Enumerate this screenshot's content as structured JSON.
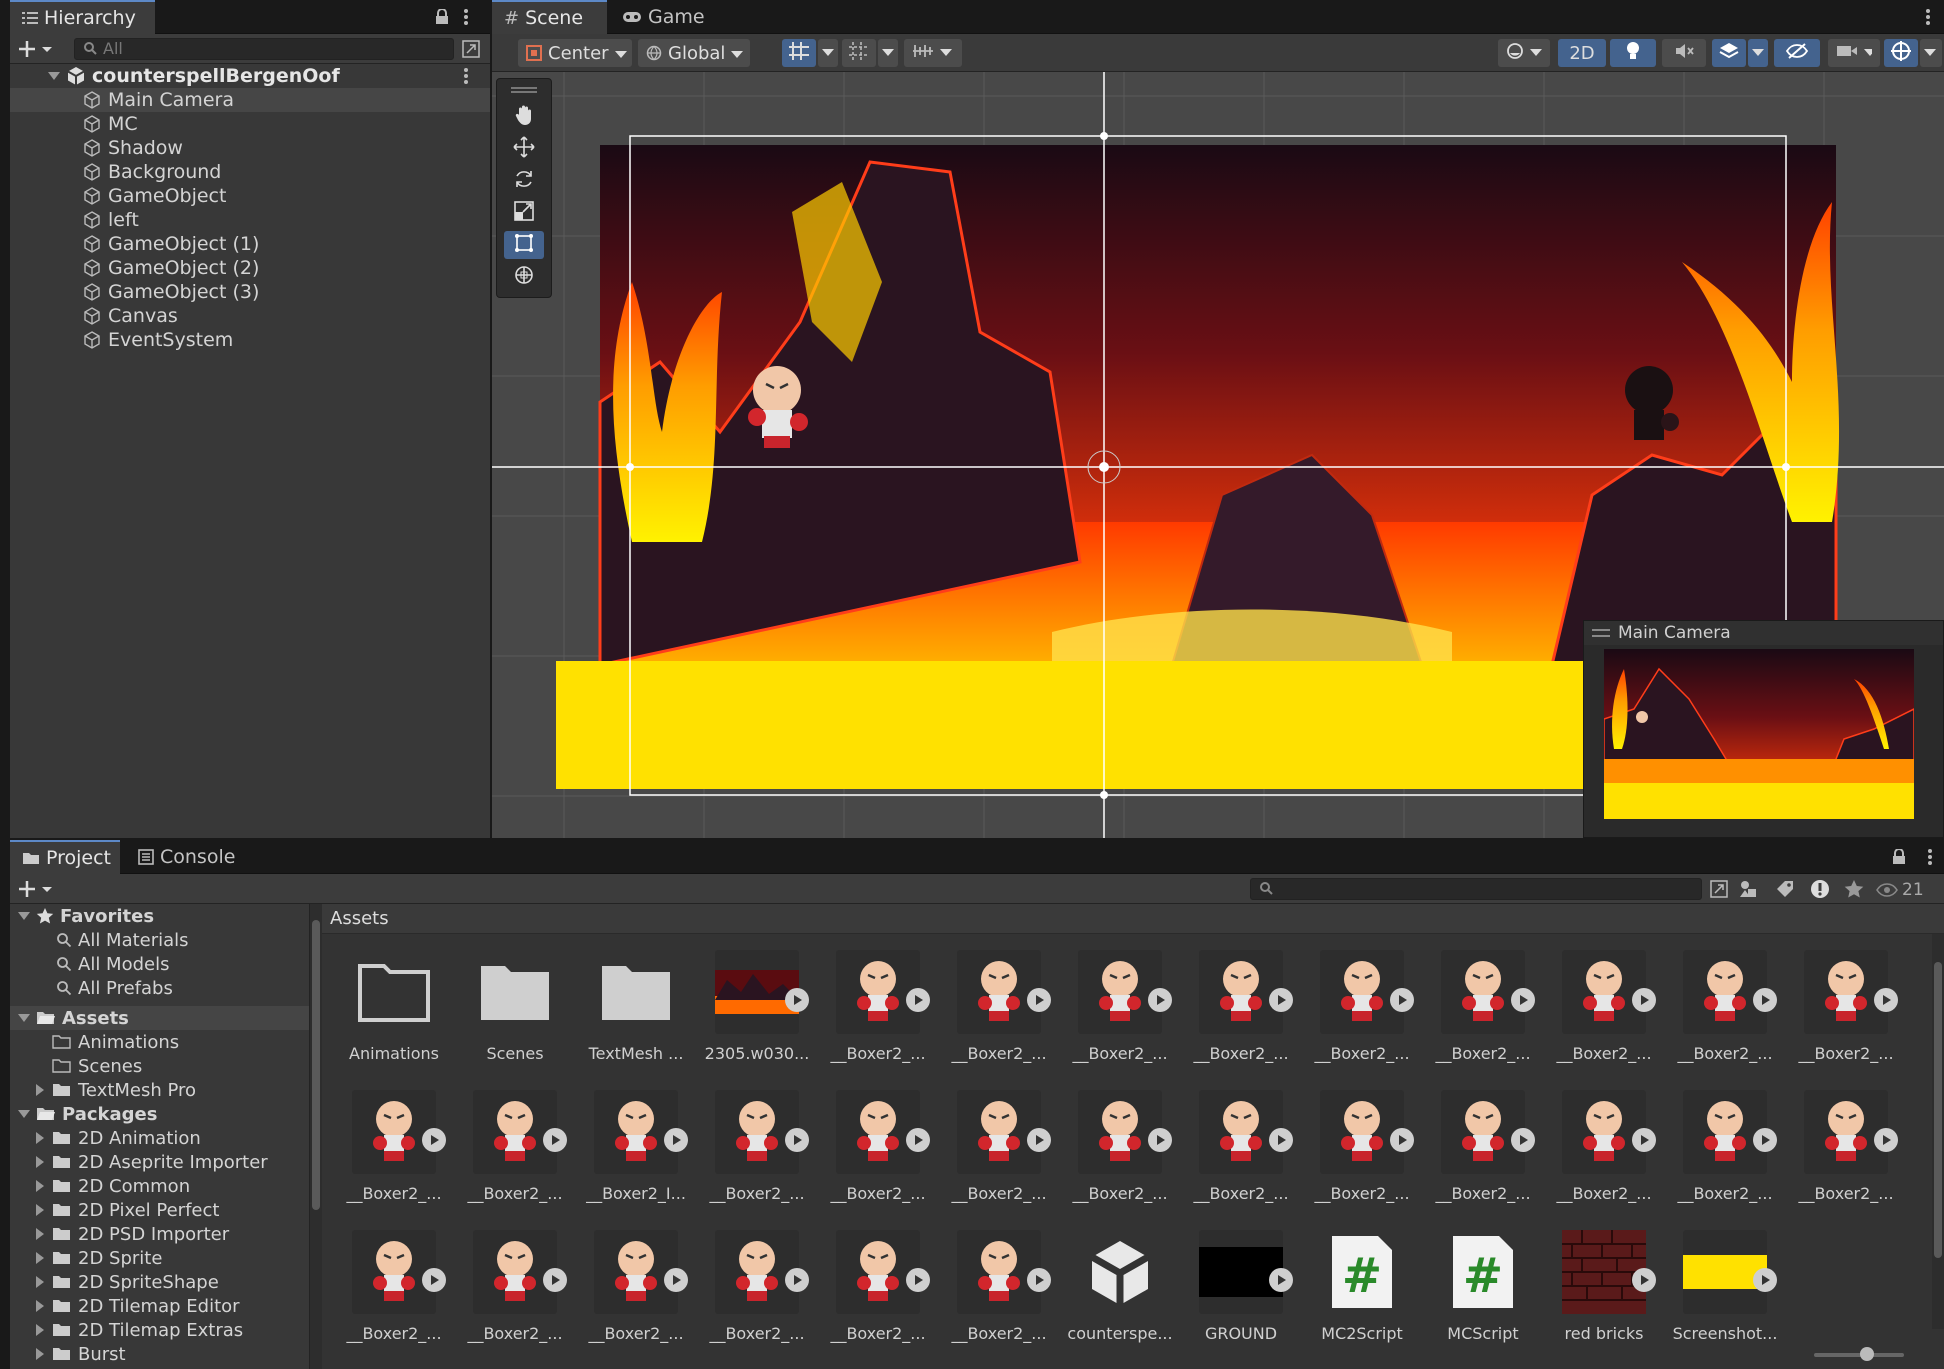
{
  "hierarchy": {
    "tab_label": "Hierarchy",
    "search_placeholder": "All",
    "scene_name": "counterspellBergenOof",
    "items": [
      {
        "label": "Main Camera"
      },
      {
        "label": "MC"
      },
      {
        "label": "Shadow"
      },
      {
        "label": "Background"
      },
      {
        "label": "GameObject"
      },
      {
        "label": "left"
      },
      {
        "label": "GameObject (1)"
      },
      {
        "label": "GameObject (2)"
      },
      {
        "label": "GameObject (3)"
      },
      {
        "label": "Canvas"
      },
      {
        "label": "EventSystem"
      }
    ]
  },
  "scene": {
    "tab_scene": "Scene",
    "tab_game": "Game",
    "pivot_label": "Center",
    "space_label": "Global",
    "mode_2d": "2D",
    "camera_preview_title": "Main Camera"
  },
  "project": {
    "tab_project": "Project",
    "tab_console": "Console",
    "breadcrumb": "Assets",
    "hidden_count": "21",
    "favorites": {
      "label": "Favorites",
      "items": [
        "All Materials",
        "All Models",
        "All Prefabs"
      ]
    },
    "assets": {
      "label": "Assets",
      "items": [
        "Animations",
        "Scenes",
        "TextMesh Pro"
      ]
    },
    "packages": {
      "label": "Packages",
      "items": [
        "2D Animation",
        "2D Aseprite Importer",
        "2D Common",
        "2D Pixel Perfect",
        "2D PSD Importer",
        "2D Sprite",
        "2D SpriteShape",
        "2D Tilemap Editor",
        "2D Tilemap Extras",
        "Burst"
      ]
    },
    "grid_rows": [
      [
        "Animations",
        "Scenes",
        "TextMesh ...",
        "2305.w030...",
        "__Boxer2_...",
        "__Boxer2_...",
        "__Boxer2_...",
        "__Boxer2_...",
        "__Boxer2_...",
        "__Boxer2_...",
        "__Boxer2_...",
        "__Boxer2_...",
        "__Boxer2_..."
      ],
      [
        "__Boxer2_...",
        "__Boxer2_...",
        "__Boxer2_I...",
        "__Boxer2_...",
        "__Boxer2_...",
        "__Boxer2_...",
        "__Boxer2_...",
        "__Boxer2_...",
        "__Boxer2_...",
        "__Boxer2_...",
        "__Boxer2_...",
        "__Boxer2_...",
        "__Boxer2_..."
      ],
      [
        "__Boxer2_...",
        "__Boxer2_...",
        "__Boxer2_...",
        "__Boxer2_...",
        "__Boxer2_...",
        "__Boxer2_...",
        "counterspe...",
        "GROUND",
        "MC2Script",
        "MCScript",
        "red bricks",
        "Screenshot..."
      ]
    ]
  },
  "colors": {
    "accent": "#44638e",
    "ground_yellow": "#ffe100",
    "lava": "#ff5a00"
  }
}
